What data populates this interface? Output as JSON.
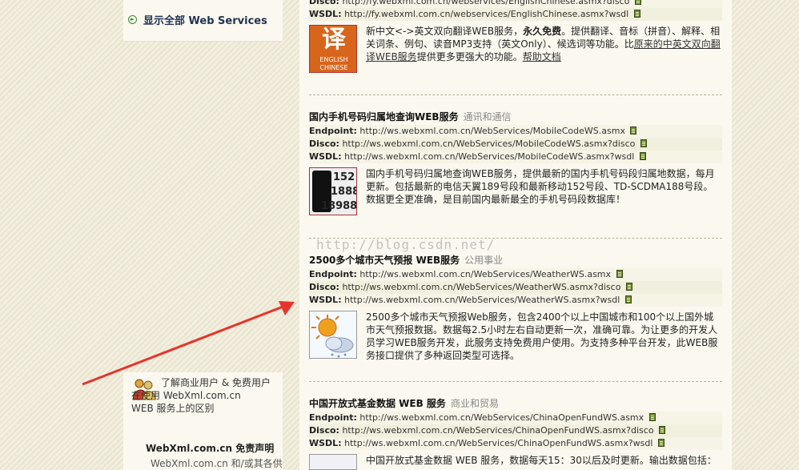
{
  "sidebar": {
    "show_all": "显示全部 Web Services",
    "promo_line1": "了解商业用户 & 免费用户",
    "promo_line2": "在使用 WebXml.com.cn",
    "promo_line3": "WEB 服务上的区别",
    "disclaimer_title": "WebXml.com.cn 免责声明",
    "disclaimer_text": "WebXml.com.cn 和/或其各供"
  },
  "services": [
    {
      "disco": "http://fy.webxml.com.cn/webservices/EnglishChinese.asmx?disco",
      "wsdl": "http://fy.webxml.com.cn/webservices/EnglishChinese.asmx?wsdl",
      "desc_a": "新中文<->英文双向翻译WEB服务，",
      "desc_bold": "永久免费",
      "desc_b": "。提供翻译、音标（拼音）、解释、相关词条、例句、读音MP3支持（英文Only）、候选词等功能。比",
      "desc_link": "原来的中英文双向翻译WEB服务",
      "desc_c": "提供更多更强大的功能。",
      "help_link": "帮助文档",
      "thumb_char": "译",
      "thumb_en1": "ENGLISH",
      "thumb_en2": "CHINESE"
    },
    {
      "title": "国内手机号码归属地查询WEB服务",
      "category": "通讯和通信",
      "endpoint": "http://ws.webxml.com.cn/WebServices/MobileCodeWS.asmx",
      "disco": "http://ws.webxml.com.cn/WebServices/MobileCodeWS.asmx?disco",
      "wsdl": "http://ws.webxml.com.cn/WebServices/MobileCodeWS.asmx?wsdl",
      "desc": "国内手机号码归属地查询WEB服务，提供最新的国内手机号码段归属地数据，每月更新。包括最新的电信天翼189号段和最新移动152号段、TD-SCDMA188号段。数据更全更准确，是目前国内最新最全的手机号码段数据库！",
      "thumb_n1": "152",
      "thumb_n2": "18888",
      "thumb_n3": "18988"
    },
    {
      "title": "2500多个城市天气预报 WEB服务",
      "category": "公用事业",
      "endpoint": "http://ws.webxml.com.cn/WebServices/WeatherWS.asmx",
      "disco": "http://ws.webxml.com.cn/WebServices/WeatherWS.asmx?disco",
      "wsdl": "http://ws.webxml.com.cn/WebServices/WeatherWS.asmx?wsdl",
      "desc": "2500多个城市天气预报Web服务，包含2400个以上中国城市和100个以上国外城市天气预报数据。数据每2.5小时左右自动更新一次，准确可靠。为让更多的开发人员学习WEB服务开发，此服务支持免费用户使用。为支持多种平台开发，此WEB服务接口提供了多种返回类型可选择。"
    },
    {
      "title": "中国开放式基金数据 WEB 服务",
      "category": "商业和贸易",
      "endpoint": "http://ws.webxml.com.cn/WebServices/ChinaOpenFundWS.asmx",
      "disco": "http://ws.webxml.com.cn/WebServices/ChinaOpenFundWS.asmx?disco",
      "wsdl": "http://ws.webxml.com.cn/WebServices/ChinaOpenFundWS.asmx?wsdl",
      "desc": "中国开放式基金数据 WEB 服务，数据每天15：30以后及时更新。输出数据包括："
    }
  ],
  "labels": {
    "endpoint": "Endpoint:",
    "disco": "Disco:",
    "wsdl": "WSDL:"
  },
  "watermark": "http://blog.csdn.net/",
  "colors": {
    "arrow": "#e8332a",
    "link": "#223355"
  }
}
